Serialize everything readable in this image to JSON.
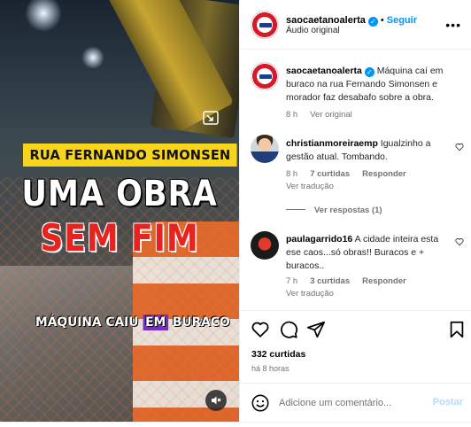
{
  "media": {
    "title_tag": "RUA FERNANDO SIMONSEN",
    "headline_line1": "UMA OBRA",
    "headline_line2": "SEM FIM",
    "caption_before": "MÁQUINA CAIU ",
    "caption_highlight": "EM",
    "caption_after": " BURACO",
    "icons": [
      "pip-icon",
      "speaker-muted-icon"
    ]
  },
  "header": {
    "username": "saocaetanoalerta",
    "follow_label": "Seguir",
    "audio_label": "Áudio original",
    "verified": true
  },
  "post": {
    "username": "saocaetanoalerta",
    "caption": "Máquina caí em buraco na rua Fernando Simonsen e morador faz desabafo sobre a obra.",
    "time": "8 h",
    "see_translation": "Ver original"
  },
  "comments": [
    {
      "username": "christianmoreiraemp",
      "text": "Igualzinho a gestão atual. Tombando.",
      "time": "8 h",
      "likes": "7 curtidas",
      "reply": "Responder",
      "translation": "Ver tradução",
      "view_replies": "Ver respostas (1)"
    },
    {
      "username": "paulagarrido16",
      "text": "A cidade inteira esta ese caos...só obras!! Buracos e + buracos..",
      "time": "7 h",
      "likes": "3 curtidas",
      "reply": "Responder",
      "translation": "Ver tradução"
    }
  ],
  "actions": {
    "likes": "332 curtidas",
    "ago": "há 8 horas",
    "icons": [
      "heart-icon",
      "comment-icon",
      "share-icon",
      "bookmark-icon"
    ]
  },
  "composer": {
    "placeholder": "Adicione um comentário...",
    "post_label": "Postar"
  },
  "colors": {
    "accent": "#0095f6",
    "title_tag_bg": "#f7d51d",
    "headline_red": "#e8231f",
    "caption_highlight_bg": "#7b2cc2"
  }
}
